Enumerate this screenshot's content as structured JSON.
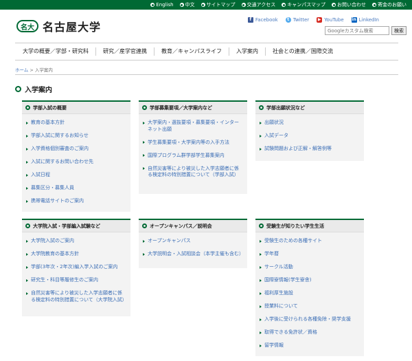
{
  "topbar": {
    "links": [
      "English",
      "中文",
      "サイトマップ",
      "交通アクセス",
      "キャンパスマップ",
      "お問い合わせ",
      "寄金のお願い"
    ]
  },
  "header": {
    "logo_mark": "名大",
    "logo_text": "名古屋大学"
  },
  "social": [
    {
      "label": "Facebook",
      "icon": "facebook-icon",
      "glyph": "f"
    },
    {
      "label": "Twitter",
      "icon": "twitter-icon",
      "glyph": "t"
    },
    {
      "label": "YouTube",
      "icon": "youtube-icon",
      "glyph": "▶"
    },
    {
      "label": "LinkedIn",
      "icon": "linkedin-icon",
      "glyph": "in"
    }
  ],
  "search": {
    "placeholder": "Googleカスタム検索",
    "button_label": "検索"
  },
  "gnav": [
    "大学の概要／学部・研究科",
    "研究／産学官連携",
    "教育／キャンパスライフ",
    "入学案内",
    "社会との連携／国際交流"
  ],
  "breadcrumb": {
    "home": "ホーム",
    "sep": " > ",
    "current": "入学案内"
  },
  "page_title": "入学案内",
  "panels": [
    {
      "title": "学部入試の概要",
      "items": [
        "教育の基本方針",
        "学部入試に関するお知らせ",
        "入学資格個別審査のご案内",
        "入試に関するお問い合わせ先",
        "入試日程",
        "募集区分・募集人員",
        "携帯電話サイトのご案内"
      ]
    },
    {
      "title": "学部募集要項／大学案内など",
      "items": [
        "大学案内・選抜要項・募集要項・インターネット出願",
        "学生募集要項・大学案内等の入手方法",
        "国際プログラム群学部学生募集案内",
        "自然災害等により被災した入学志願者に係る検定料の特別措置について（学部入試）"
      ]
    },
    {
      "title": "学部出願状況など",
      "items": [
        "出願状況",
        "入試データ",
        "試験問題および正解・解答例等"
      ]
    },
    {
      "title": "大学院入試・学部編入試験など",
      "items": [
        "大学院入試のご案内",
        "大学院教育の基本方針",
        "学部(3年次・2年次)編入学入試のご案内",
        "研究生・科目等履修生のご案内",
        "自然災害等により被災した入学志願者に係る検定料の特別措置について（大学院入試）"
      ]
    },
    {
      "title": "オープンキャンパス／説明会",
      "items": [
        "オープンキャンパス",
        "大学説明会・入試相談会（本学主催も含む）"
      ]
    },
    {
      "title": "受験生が知りたい学生生活",
      "items": [
        "受験生のための各種サイト",
        "学年暦",
        "サークル活動",
        "国際寮情報(学生寮舎)",
        "福利厚生施設",
        "授業料について",
        "入学後に受けられる各種免除・奨学支援",
        "取得できる免許状／資格",
        "留学情報"
      ]
    }
  ]
}
